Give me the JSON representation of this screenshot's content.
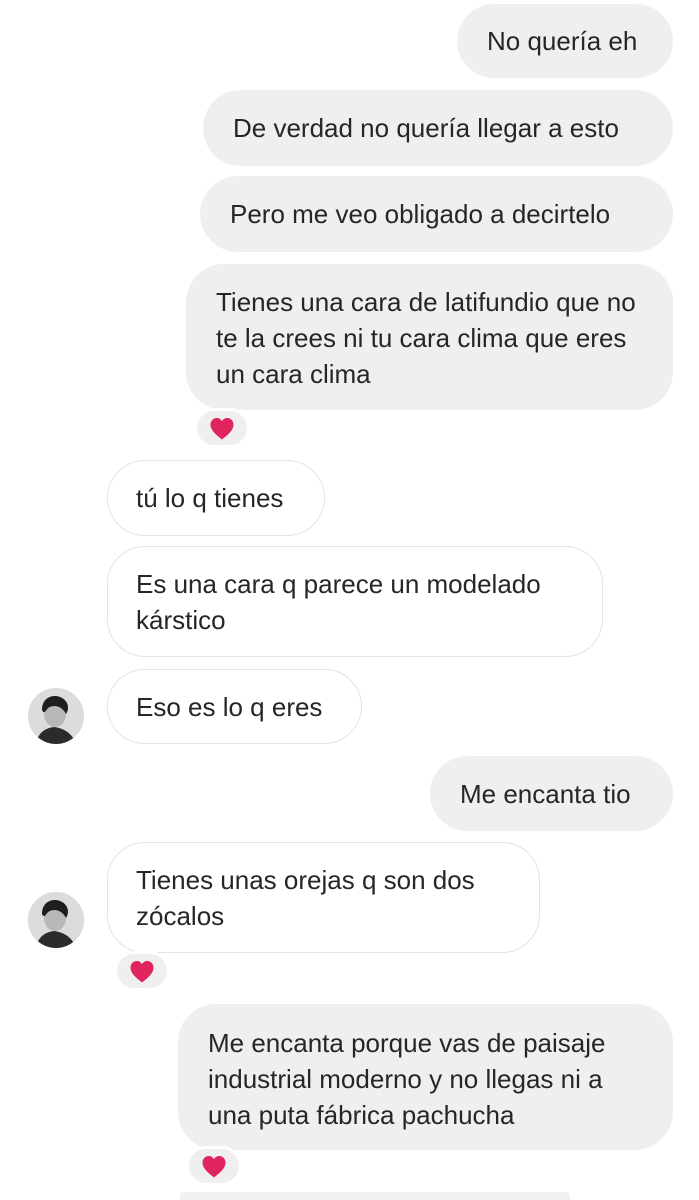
{
  "messages": [
    {
      "id": "m1",
      "dir": "out",
      "text": "No quería eh"
    },
    {
      "id": "m2",
      "dir": "out",
      "text": "De verdad no quería llegar a esto"
    },
    {
      "id": "m3",
      "dir": "out",
      "text": "Pero me veo obligado a decirtelo"
    },
    {
      "id": "m4",
      "dir": "out",
      "text": "Tienes una cara de latifundio que no te la crees ni tu cara clima que eres un cara clima",
      "reaction": "heart"
    },
    {
      "id": "m5",
      "dir": "in",
      "text": "tú lo q tienes"
    },
    {
      "id": "m6",
      "dir": "in",
      "text": "Es una cara q parece un modelado kárstico"
    },
    {
      "id": "m7",
      "dir": "in",
      "text": "Eso es lo q eres",
      "avatar": true
    },
    {
      "id": "m8",
      "dir": "out",
      "text": "Me encanta tio"
    },
    {
      "id": "m9",
      "dir": "in",
      "text": "Tienes unas orejas q son dos zócalos",
      "avatar": true,
      "reaction": "heart"
    },
    {
      "id": "m10",
      "dir": "out",
      "text": "Me encanta porque vas de paisaje industrial moderno y no llegas ni a una puta fábrica pachucha",
      "reaction": "heart"
    }
  ],
  "reaction_icon": "heart-icon",
  "colors": {
    "outgoing_bubble": "#efefef",
    "incoming_border": "#e3e3e3",
    "text": "#262626",
    "heart": "#e0245e"
  }
}
